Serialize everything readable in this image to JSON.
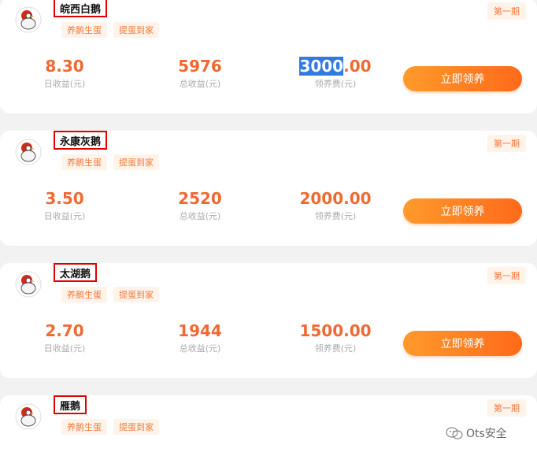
{
  "tags": [
    "养鹅生蛋",
    "提蛋到家"
  ],
  "period_label": "第一期",
  "stat_labels": {
    "daily": "日收益(元)",
    "total": "总收益(元)",
    "fee": "领养费(元)"
  },
  "adopt_label": "立即领养",
  "cards": [
    {
      "name": "皖西白鹅",
      "daily": "8.30",
      "total": "5976",
      "fee_highlight": "3000",
      "fee_rest": ".00"
    },
    {
      "name": "永康灰鹅",
      "daily": "3.50",
      "total": "2520",
      "fee_highlight": "",
      "fee_rest": "2000.00"
    },
    {
      "name": "太湖鹅",
      "daily": "2.70",
      "total": "1944",
      "fee_highlight": "",
      "fee_rest": "1500.00"
    },
    {
      "name": "雁鹅"
    }
  ],
  "watermark": "Ots安全",
  "colors": {
    "accent": "#ef6a33",
    "button_start": "#ff9a2b",
    "button_end": "#ff6a1a",
    "highlight_box": "#e00000"
  }
}
